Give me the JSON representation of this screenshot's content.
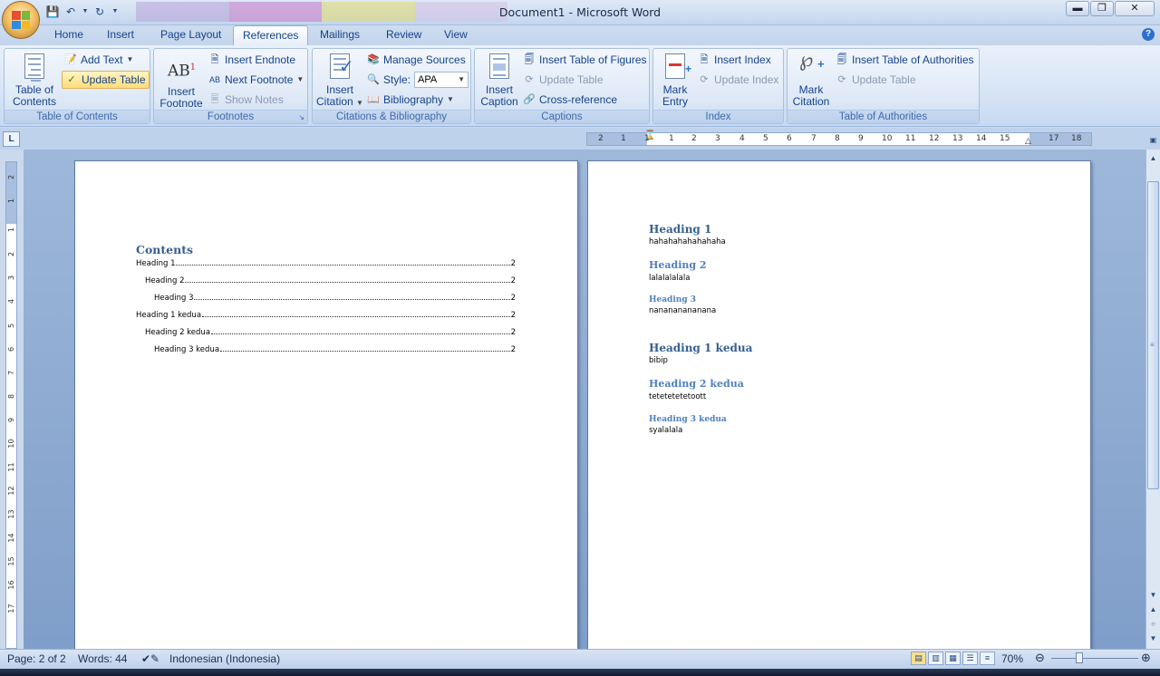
{
  "window": {
    "title": "Document1 - Microsoft Word"
  },
  "tabs": [
    {
      "label": "Home"
    },
    {
      "label": "Insert"
    },
    {
      "label": "Page Layout"
    },
    {
      "label": "References"
    },
    {
      "label": "Mailings"
    },
    {
      "label": "Review"
    },
    {
      "label": "View"
    }
  ],
  "ribbon": {
    "toc": {
      "toc_line1": "Table of",
      "toc_line2": "Contents",
      "add_text": "Add Text",
      "update_table": "Update Table",
      "group_title": "Table of Contents"
    },
    "footnotes": {
      "insert_line1": "Insert",
      "insert_line2": "Footnote",
      "insert_endnote": "Insert Endnote",
      "next_footnote": "Next Footnote",
      "show_notes": "Show Notes",
      "group_title": "Footnotes"
    },
    "citations": {
      "insert_line1": "Insert",
      "insert_line2": "Citation",
      "manage_sources": "Manage Sources",
      "style_label": "Style:",
      "style_value": "APA",
      "bibliography": "Bibliography",
      "group_title": "Citations & Bibliography"
    },
    "captions": {
      "insert_line1": "Insert",
      "insert_line2": "Caption",
      "insert_tof": "Insert Table of Figures",
      "update_table": "Update Table",
      "cross_ref": "Cross-reference",
      "group_title": "Captions"
    },
    "index": {
      "mark_line1": "Mark",
      "mark_line2": "Entry",
      "insert_index": "Insert Index",
      "update_index": "Update Index",
      "group_title": "Index"
    },
    "authorities": {
      "mark_line1": "Mark",
      "mark_line2": "Citation",
      "insert_toa": "Insert Table of Authorities",
      "update_table": "Update Table",
      "group_title": "Table of Authorities"
    }
  },
  "ruler": {
    "h_marks": [
      "2",
      "1",
      "1",
      "1",
      "2",
      "3",
      "4",
      "5",
      "6",
      "7",
      "8",
      "9",
      "10",
      "11",
      "12",
      "13",
      "14",
      "15",
      "17",
      "18"
    ],
    "v_marks": [
      "2",
      "1",
      "1",
      "2",
      "3",
      "4",
      "5",
      "6",
      "7",
      "8",
      "9",
      "10",
      "11",
      "12",
      "13",
      "14",
      "15",
      "16",
      "17"
    ]
  },
  "page1": {
    "contents_title": "Contents",
    "toc_entries": [
      {
        "text": "Heading 1",
        "page": "2",
        "level": 1
      },
      {
        "text": "Heading 2",
        "page": "2",
        "level": 2
      },
      {
        "text": "Heading 3",
        "page": "2",
        "level": 3
      },
      {
        "text": "Heading 1 kedua",
        "page": "2",
        "level": 1
      },
      {
        "text": "Heading 2 kedua",
        "page": "2",
        "level": 2
      },
      {
        "text": "Heading 3 kedua",
        "page": "2",
        "level": 3
      }
    ]
  },
  "page2": {
    "sections": [
      {
        "heading": "Heading 1",
        "level": 1,
        "body": "hahahahahahahaha"
      },
      {
        "heading": "Heading 2",
        "level": 2,
        "body": "lalalalalala"
      },
      {
        "heading": "Heading 3",
        "level": 3,
        "body": "nanananananana"
      },
      {
        "heading": "Heading 1 kedua",
        "level": 1,
        "body": "bibip"
      },
      {
        "heading": "Heading 2 kedua",
        "level": 2,
        "body": "tetetetetetoott"
      },
      {
        "heading": "Heading 3 kedua",
        "level": 3,
        "body": "syalalala"
      }
    ]
  },
  "statusbar": {
    "page": "Page: 2 of 2",
    "words": "Words: 44",
    "language": "Indonesian (Indonesia)",
    "zoom": "70%"
  },
  "colors": {
    "heading1": "#365f91",
    "heading2": "#4f81bd",
    "ribbon_text": "#15428b"
  }
}
